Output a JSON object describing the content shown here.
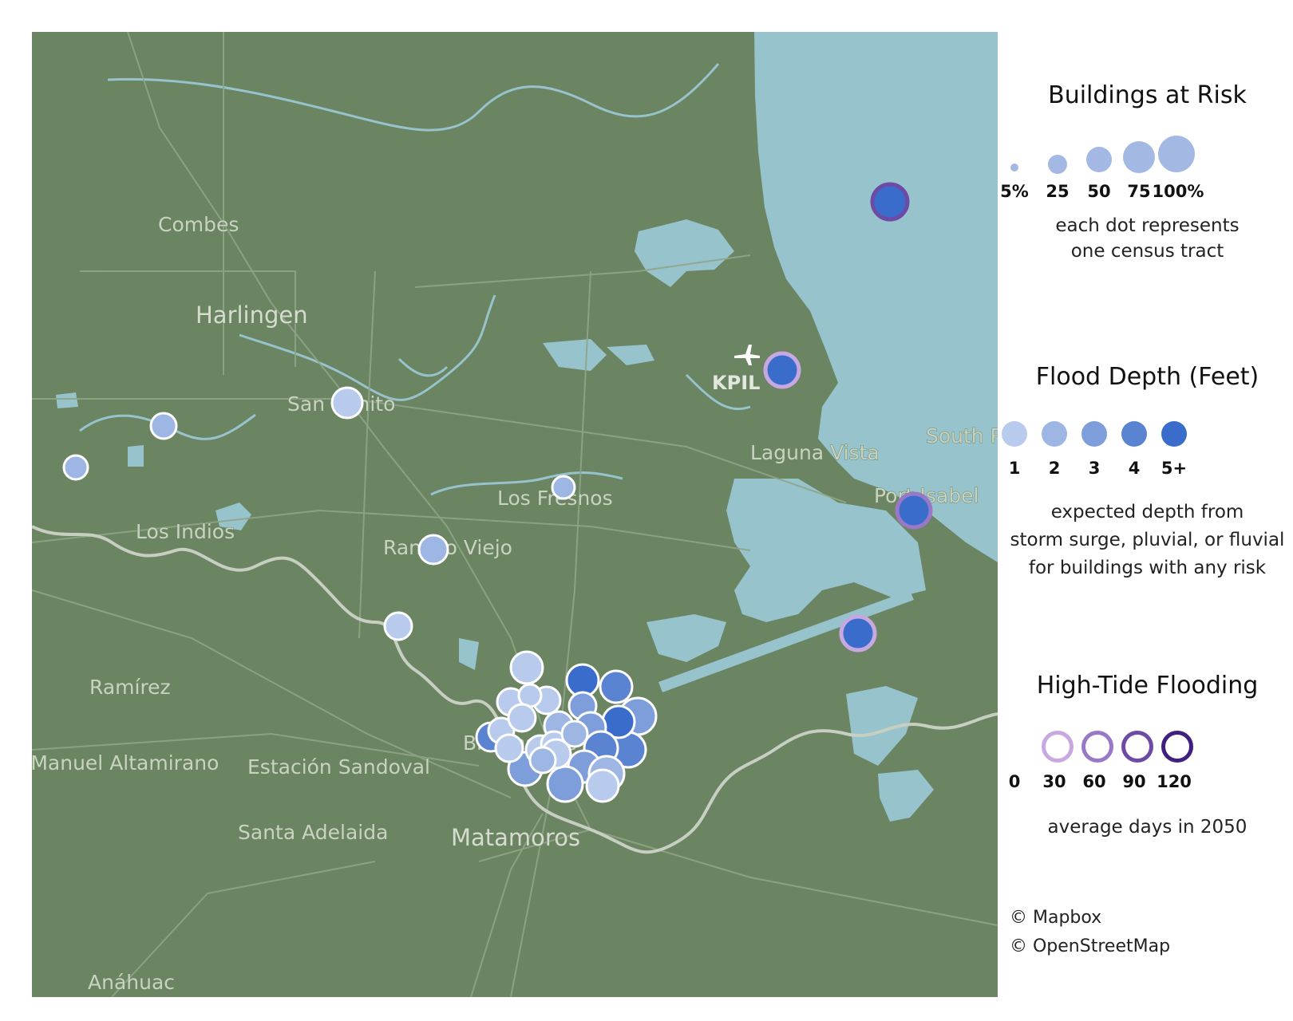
{
  "map": {
    "places": [
      {
        "name": "Combes",
        "kind": "town"
      },
      {
        "name": "Harlingen",
        "kind": "city"
      },
      {
        "name": "San Benito",
        "kind": "town"
      },
      {
        "name": "Los Indios",
        "kind": "town"
      },
      {
        "name": "Los Fresnos",
        "kind": "town"
      },
      {
        "name": "Rancho Viejo",
        "kind": "town"
      },
      {
        "name": "Laguna Vista",
        "kind": "town"
      },
      {
        "name": "Port Isabel",
        "kind": "town"
      },
      {
        "name": "South Padre",
        "kind": "town"
      },
      {
        "name": "Ramírez",
        "kind": "town"
      },
      {
        "name": "Estación Sandoval",
        "kind": "town"
      },
      {
        "name": "Ignacio Manuel Altamirano",
        "kind": "town"
      },
      {
        "name": "Santa Adelaida",
        "kind": "town"
      },
      {
        "name": "Matamoros",
        "kind": "city"
      },
      {
        "name": "Anáhuac",
        "kind": "town"
      },
      {
        "name": "Brownsville",
        "kind": "city"
      }
    ],
    "airport": {
      "code": "KPIL",
      "icon": "airplane-icon"
    },
    "colors": {
      "land": "#6b8461",
      "water": "#97c3cc",
      "road": "#8fa587",
      "border": "#c6cfc1",
      "depth": [
        "#b8cbec",
        "#9db6e3",
        "#7e9ddb",
        "#5a84d2",
        "#3a6ccb"
      ],
      "tide": [
        "#c7a8e0",
        "#9a78c8",
        "#6c4aa6",
        "#3f1f7f"
      ]
    }
  },
  "legend": {
    "buildings": {
      "title": "Buildings at Risk",
      "ticks": [
        "5%",
        "25",
        "50",
        "75",
        "100%"
      ],
      "note_lines": [
        "each dot represents",
        "one census tract"
      ]
    },
    "depth": {
      "title": "Flood Depth (Feet)",
      "ticks": [
        "1",
        "2",
        "3",
        "4",
        "5+"
      ],
      "note_lines": [
        "expected depth from",
        "storm surge, pluvial, or fluvial",
        "for buildings with any risk"
      ]
    },
    "tide": {
      "title": "High-Tide Flooding",
      "ticks": [
        "0",
        "30",
        "60",
        "90",
        "120"
      ],
      "note_lines": [
        "average days in 2050"
      ]
    },
    "credits": [
      "© Mapbox",
      "© OpenStreetMap"
    ]
  }
}
